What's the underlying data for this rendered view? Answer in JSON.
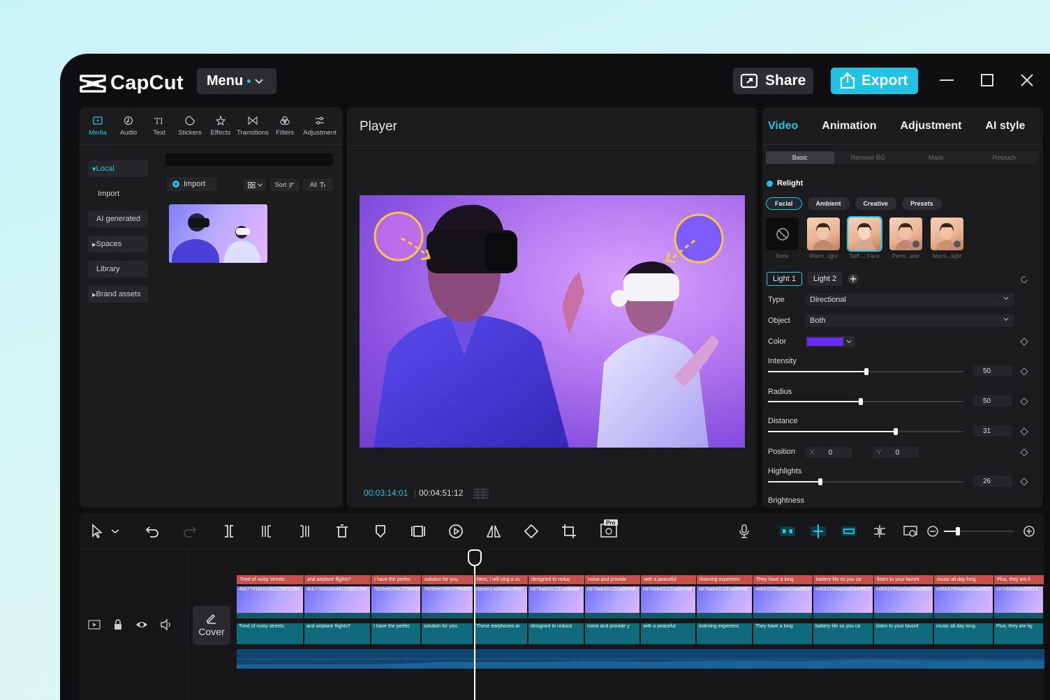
{
  "app": {
    "name": "CapCut",
    "menu_label": "Menu",
    "share_label": "Share",
    "export_label": "Export"
  },
  "media": {
    "tools": [
      {
        "label": "Media",
        "icon": "media-icon",
        "active": true
      },
      {
        "label": "Audio",
        "icon": "audio-icon"
      },
      {
        "label": "Text",
        "icon": "text-icon"
      },
      {
        "label": "Stickers",
        "icon": "stickers-icon"
      },
      {
        "label": "Effects",
        "icon": "effects-icon"
      },
      {
        "label": "Transitions",
        "icon": "transitions-icon"
      },
      {
        "label": "Filters",
        "icon": "filters-icon"
      },
      {
        "label": "Adjustment",
        "icon": "adjustment-icon"
      }
    ],
    "sidebar": [
      "Local",
      "Import",
      "AI generated",
      "Spaces",
      "Library",
      "Brand assets"
    ],
    "import_label": "Import",
    "sort_label": "Sort",
    "filter_label": "All"
  },
  "player": {
    "title": "Player",
    "current_time": "00:03:14:01",
    "total_time": "00:04:51:12"
  },
  "props": {
    "tabs": [
      "Video",
      "Animation",
      "Adjustment",
      "AI style"
    ],
    "subtabs": [
      "Basic",
      "Remove BG",
      "Mask",
      "Retouch"
    ],
    "relight_label": "Relight",
    "pills": [
      "Facial",
      "Ambient",
      "Creative",
      "Presets"
    ],
    "presets": [
      "None",
      "Warm...ight",
      "Soft ... Face",
      "Perm...ater",
      "Morni...light"
    ],
    "lights": [
      "Light 1",
      "Light 2"
    ],
    "type_label": "Type",
    "type_value": "Directional",
    "object_label": "Object",
    "object_value": "Both",
    "color_label": "Color",
    "color_value": "#6a2cf3",
    "intensity_label": "Intensity",
    "intensity_value": "50",
    "radius_label": "Radius",
    "radius_value": "50",
    "distance_label": "Distance",
    "distance_value": "31",
    "position_label": "Position",
    "pos_x_label": "X",
    "pos_x": "0",
    "pos_y_label": "Y",
    "pos_y": "0",
    "highlights_label": "Highlights",
    "highlights_value": "26",
    "brightness_label": "Brightness"
  },
  "timeline": {
    "cover_label": "Cover",
    "pro_badge": "Pro",
    "captions": [
      "Tired of noisy streets",
      "and airplane flights?",
      "I have the perfec",
      "solution for you.",
      "Next, I will sing a so",
      "designed to reduc",
      "noise and provide",
      "with a peaceful",
      "listening experienc",
      "They have a long",
      "battery life so you ca",
      "listen to your favorit",
      "music all day long.",
      "Plus, they are li"
    ],
    "video_clips": [
      "4bb7791bc0c481228811f4e",
      "4bb7791bc0c481228811f4e",
      "7829eec05e1f796482",
      "7829eec05e1f796482",
      "daniel-j-schwarz-Wnr",
      "b878ab42c231a6b0a8",
      "b878ab42c231a6b0a8",
      "b878ab42c231a6b0a8",
      "b878ab42c231a6b0a8",
      "ed683299aa6ad2aad8b3",
      "ed683299aa6ad2aad8b3",
      "ed683299aa6ad2aad8b3",
      "ed683299aa6ad2aad8b3",
      "ce7cb308a9d9f514"
    ],
    "audio_clips": [
      "Tired of noisy streets",
      "and airplane flights?",
      "I have the perfec",
      "solution for you.",
      "These earphones ar",
      "designed to reduce",
      "noise and provide y",
      "with a peaceful",
      "listening experienc",
      "They have a long",
      "battery life so you ca",
      "listen to your favorit",
      "music all day long.",
      "Plus, they are lig"
    ]
  }
}
